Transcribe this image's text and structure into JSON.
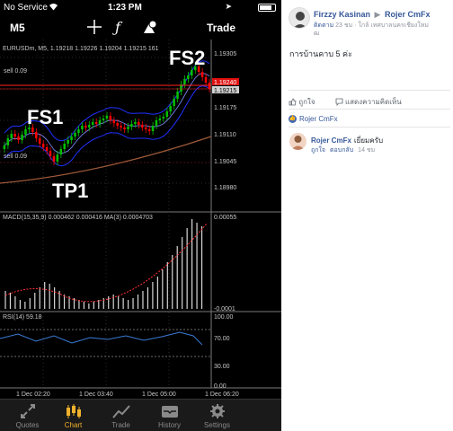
{
  "status": {
    "carrier": "No Service",
    "time": "1:23 PM",
    "wifi_icon": "wifi-icon",
    "location_icon": "location-icon",
    "battery_icon": "battery-icon"
  },
  "toolbar": {
    "timeframe": "M5",
    "trade": "Trade",
    "icons": [
      "crosshair-icon",
      "function-icon",
      "objects-icon"
    ]
  },
  "chart": {
    "info": "EURUSDm, M5, 1.19218 1.19226 1.19204 1.19215 161",
    "sell_label_top": "sell 0.09",
    "sell_label_bottom": "sell 0.09",
    "annotations": {
      "fs1": "FS1",
      "fs2": "FS2",
      "tp1": "TP1"
    },
    "price_ticks": [
      "1.19305",
      "1.19240",
      "1.19215",
      "1.19175",
      "1.19110",
      "1.19045",
      "1.18980"
    ],
    "macd_label": "MACD(15,35,9) 0.000462 0.000416 MA(3) 0.0004703",
    "macd_ticks": [
      "0.00055",
      "-0.0001"
    ],
    "rsi_label": "RSI(14) 59.18",
    "rsi_ticks": [
      "100.00",
      "70.00",
      "30.00",
      "0.00"
    ],
    "time_ticks": [
      "1 Dec 02:20",
      "1 Dec 03:40",
      "1 Dec 05:00",
      "1 Dec 06:20"
    ],
    "colors": {
      "bull": "#00c000",
      "bear": "#ff0000",
      "grid": "#2a2a2a",
      "text": "#c8c8c8",
      "ma_blue": "#2030ff",
      "ma_brown": "#a05a3a"
    }
  },
  "tabs": [
    {
      "label": "Quotes",
      "icon": "quotes-icon",
      "active": false
    },
    {
      "label": "Chart",
      "icon": "chart-icon",
      "active": true
    },
    {
      "label": "Trade",
      "icon": "trade-icon",
      "active": false
    },
    {
      "label": "History",
      "icon": "history-icon",
      "active": false
    },
    {
      "label": "Settings",
      "icon": "settings-icon",
      "active": false
    }
  ],
  "post": {
    "author": "Firzzy Kasinan",
    "arrow": "▶",
    "target": "Rojer CmFx",
    "follow": "ติดตาม",
    "meta": "23 ชม · ใกล้ เทศบาลนครเชียงใหม่",
    "meta2": "ฒ",
    "text": "การบ้านคาบ 5 ค่ะ",
    "like_action": "ถูกใจ",
    "comment_action": "แสดงความคิดเห็น",
    "reaction_name": "Rojer CmFx",
    "comment": {
      "author": "Rojer CmFx",
      "text": "เยี่ยมครับ",
      "like": "ถูกใจ",
      "reply": "ตอบกลับ",
      "time": "14 ชม"
    }
  }
}
